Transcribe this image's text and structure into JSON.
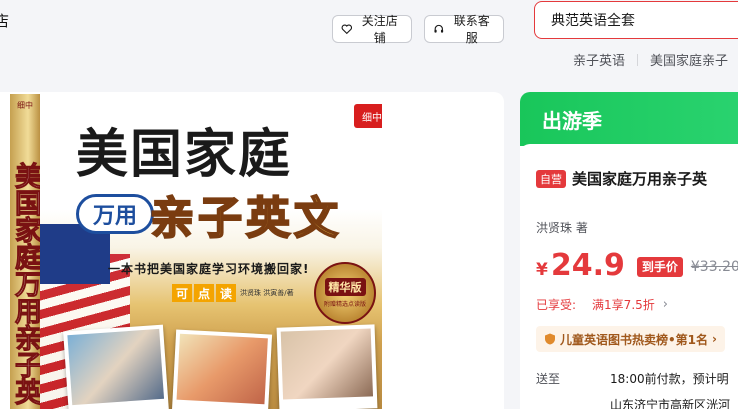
{
  "header": {
    "cut_char": "店",
    "follow_label": "关注店铺",
    "service_label": "联系客服"
  },
  "search": {
    "value": "典范英语全套",
    "hot_words": [
      "亲子英语",
      "美国家庭亲子"
    ]
  },
  "product_image": {
    "spine_top": "细中",
    "spine_text": "美国家庭万用亲子英",
    "brand_tag": "细中",
    "title_main": "美国家庭",
    "title_pill": "万用",
    "title_sub": "亲子英文",
    "slogan": "一本书把美国家庭学习环境搬回家!",
    "read_chars": [
      "可",
      "点",
      "读"
    ],
    "authors": "洪贤珠    洪寅善/著",
    "badge_main": "精华版",
    "badge_sub": "附赠精选点读版"
  },
  "promo": {
    "label": "出游季"
  },
  "product": {
    "self_run_tag": "自营",
    "title": "美国家庭万用亲子英",
    "author": "洪贤珠 著",
    "price_symbol": "¥",
    "price": "24.9",
    "price_tag": "到手价",
    "original_price": "¥33.20",
    "enjoy_label": "已享受:",
    "enjoy_value": "满1享7.5折",
    "enjoy_chevron": "›",
    "rank_text": "儿童英语图书热卖榜•第1名",
    "rank_chevron": "›",
    "delivery_label": "送至",
    "delivery_value": "18:00前付款，预计明",
    "address": "山东济宁市高新区洸河"
  },
  "colors": {
    "accent": "#e4393c",
    "promo_green": "#19c65a"
  }
}
